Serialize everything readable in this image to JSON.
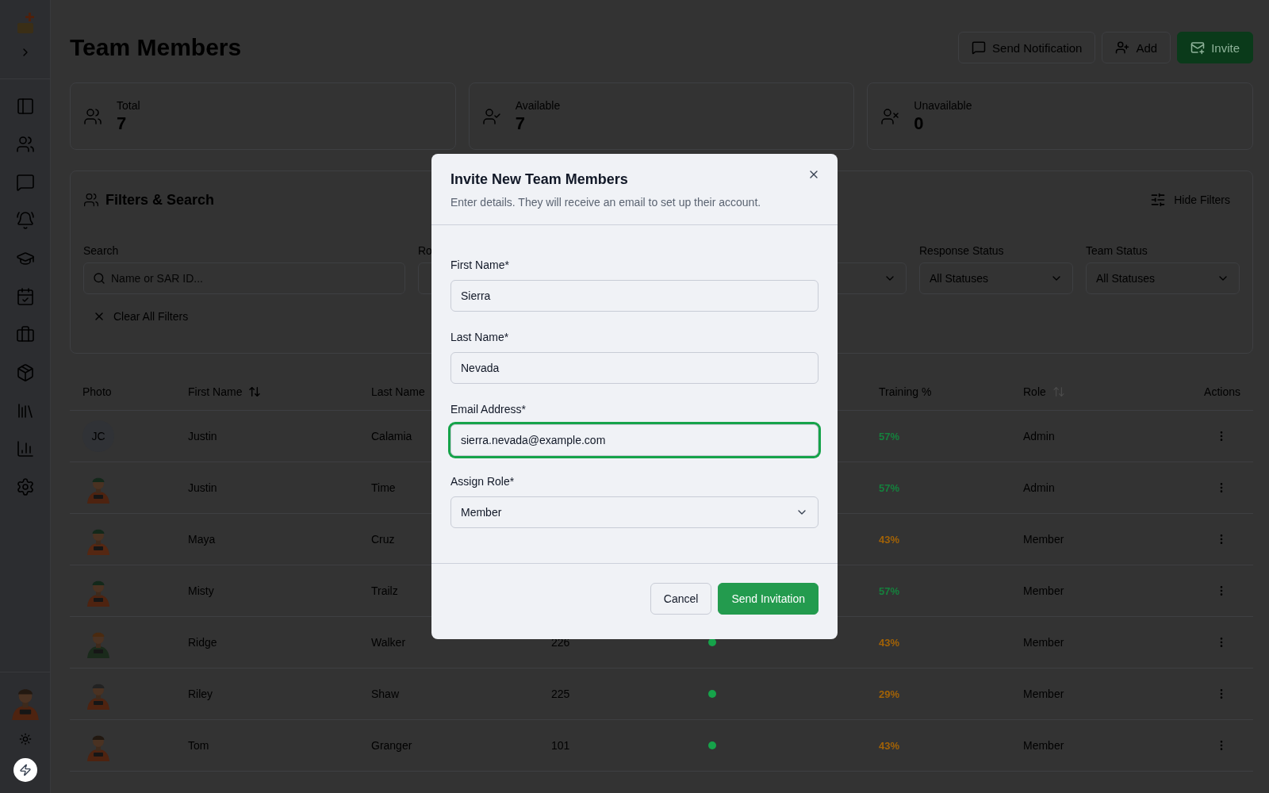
{
  "header": {
    "title": "Team Members",
    "buttons": [
      {
        "label": "Send Notification",
        "kind": "outline"
      },
      {
        "label": "Add",
        "kind": "outline"
      },
      {
        "label": "Invite",
        "kind": "primary"
      }
    ]
  },
  "stats": [
    {
      "label": "Total",
      "value": "7"
    },
    {
      "label": "Available",
      "value": "7"
    },
    {
      "label": "Unavailable",
      "value": "0"
    }
  ],
  "filters": {
    "title": "Filters & Search",
    "toggle": "Hide Filters",
    "clear": "Clear All Filters",
    "fields": [
      {
        "kind": "search",
        "label": "Search",
        "placeholder": "Name or SAR ID..."
      },
      {
        "kind": "select",
        "label": "Ro"
      },
      {
        "kind": "select"
      },
      {
        "kind": "select",
        "label": "Response Status",
        "value": "All Statuses"
      },
      {
        "kind": "select",
        "label": "Team Status",
        "value": "All Statuses"
      }
    ]
  },
  "table": {
    "columns": [
      {
        "label": "Photo",
        "sortable": false
      },
      {
        "label": "First Name",
        "sortable": true,
        "sorted": true
      },
      {
        "label": "Last Name",
        "sortable": false
      },
      {
        "label": "Training %",
        "sortable": false
      },
      {
        "label": "Role",
        "sortable": true,
        "sorted": false
      },
      {
        "label": "Actions",
        "sortable": false
      }
    ],
    "rows": [
      {
        "photo": {
          "kind": "initials",
          "text": "JC"
        },
        "first": "Justin",
        "last": "Calamia",
        "training": {
          "text": "57%",
          "color": "#15803d"
        },
        "role": "Admin"
      },
      {
        "first": "Justin",
        "last": "Time",
        "training": {
          "text": "57%",
          "color": "#15803d"
        },
        "role": "Admin"
      },
      {
        "first": "Maya",
        "last": "Cruz",
        "training": {
          "text": "43%",
          "color": "#a16207"
        },
        "role": "Member"
      },
      {
        "first": "Misty",
        "last": "Trailz",
        "training": {
          "text": "57%",
          "color": "#15803d"
        },
        "role": "Member"
      },
      {
        "first": "Ridge",
        "last": "Walker",
        "sar_id": "226",
        "status": {
          "color": "#16a34a"
        },
        "training": {
          "text": "43%",
          "color": "#a16207"
        },
        "role": "Member"
      },
      {
        "first": "Riley",
        "last": "Shaw",
        "sar_id": "225",
        "status": {
          "color": "#16a34a"
        },
        "training": {
          "text": "29%",
          "color": "#a16207"
        },
        "role": "Member"
      },
      {
        "first": "Tom",
        "last": "Granger",
        "sar_id": "101",
        "status": {
          "color": "#16a34a"
        },
        "training": {
          "text": "43%",
          "color": "#a16207"
        },
        "role": "Member"
      }
    ]
  },
  "modal": {
    "title": "Invite New Team Members",
    "subtitle": "Enter details. They will receive an email to set up their account.",
    "fields": [
      {
        "kind": "text",
        "label": "First Name*",
        "value": "Sierra",
        "focused": false
      },
      {
        "kind": "text",
        "label": "Last Name*",
        "value": "Nevada",
        "focused": false
      },
      {
        "kind": "text",
        "label": "Email Address*",
        "value": "sierra.nevada@example.com",
        "focused": true
      },
      {
        "kind": "select",
        "label": "Assign Role*",
        "value": "Member",
        "focused": false
      }
    ],
    "buttons": [
      {
        "label": "Cancel",
        "kind": "outline"
      },
      {
        "label": "Send Invitation",
        "kind": "primary"
      }
    ]
  }
}
